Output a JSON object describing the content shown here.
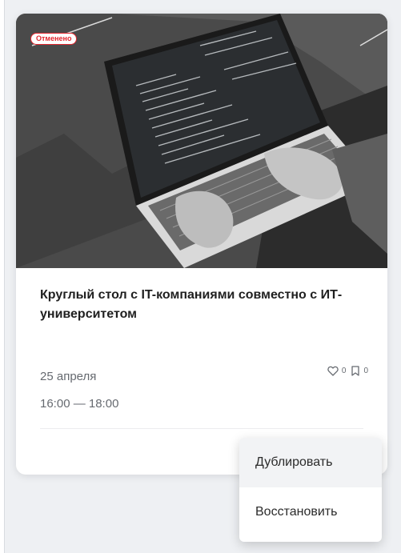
{
  "event": {
    "status": "Отменено",
    "title": "Круглый стол с IT-компаниями совместно с ИТ-университетом",
    "date": "25 апреля",
    "time": "16:00 — 18:00",
    "likes": "0",
    "bookmarks": "0"
  },
  "menu": {
    "items": [
      {
        "label": "Дублировать"
      },
      {
        "label": "Восстановить"
      }
    ]
  },
  "colors": {
    "accent": "#e3262e",
    "text": "#1f1f1f",
    "muted": "#666a70",
    "page": "#eef0f3"
  },
  "icons": [
    "heart-icon",
    "bookmark-icon"
  ]
}
